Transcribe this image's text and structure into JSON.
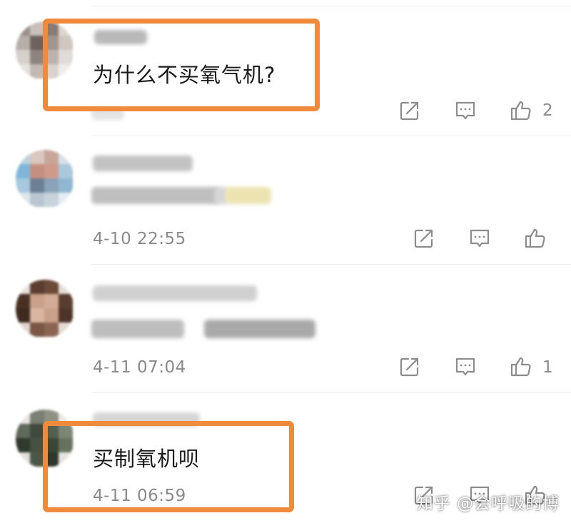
{
  "colors": {
    "highlight": "#f08a3c",
    "divider": "#ececec",
    "meta_text": "#8a8a8a",
    "icon_stroke": "#8c8c8c"
  },
  "comments": [
    {
      "content": "为什么不买氧气机?",
      "timestamp": "",
      "like_count": "2",
      "icons": [
        "share-icon",
        "reply-icon",
        "like-icon"
      ]
    },
    {
      "content": "",
      "timestamp": "4-10 22:55",
      "like_count": "",
      "icons": [
        "share-icon",
        "reply-icon",
        "like-icon"
      ]
    },
    {
      "content": "",
      "timestamp": "4-11 07:04",
      "like_count": "1",
      "icons": [
        "share-icon",
        "reply-icon",
        "like-icon"
      ]
    },
    {
      "content": "买制氧机呗",
      "timestamp": "4-11 06:59",
      "like_count": "",
      "icons": [
        "share-icon",
        "reply-icon",
        "like-icon"
      ]
    }
  ],
  "watermark": "知乎 @会呼吸的博"
}
